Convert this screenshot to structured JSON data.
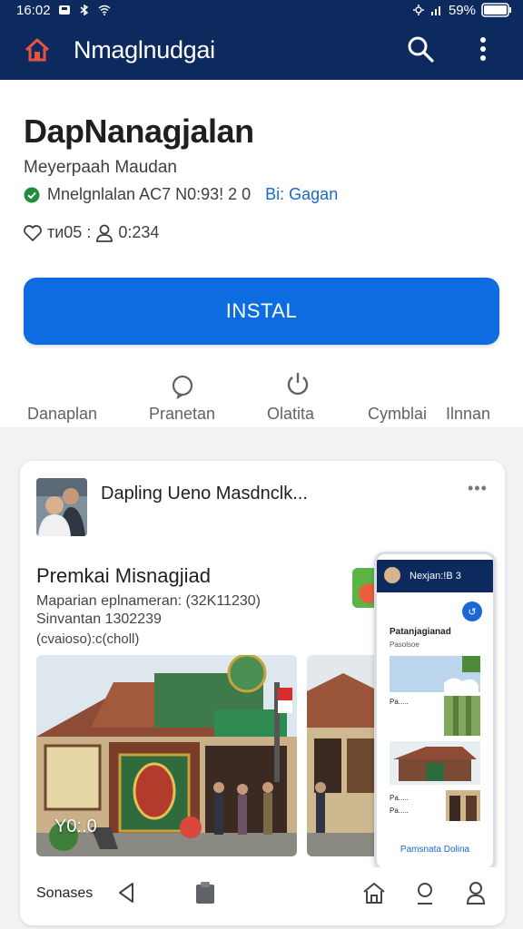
{
  "status": {
    "time": "16:02",
    "battery": "59%"
  },
  "appbar": {
    "title": "Nmaglnudgai"
  },
  "app": {
    "title": "DapNanagjalan",
    "publisher": "Meyerpaah Maudan",
    "verified_text": "Mnelgnlalan AC7 N0:93! 2 0",
    "verified_link": "Bi: Gagan",
    "stats_left": "ти05 :",
    "stats_right": "0:234",
    "install_label": "INSTAL"
  },
  "actions": [
    {
      "label": "Danaplan",
      "icon": "none"
    },
    {
      "label": "Pranetan",
      "icon": "comment-icon"
    },
    {
      "label": "Olatita",
      "icon": "power-icon"
    },
    {
      "label": "Cymblai",
      "icon": "none"
    },
    {
      "label": "Ilnnan",
      "icon": "none"
    }
  ],
  "card": {
    "header": "Dapling Ueno Masdnclk...",
    "more": "•••",
    "post_title": "Premkai Misnagjiad",
    "line1": "Maparian eplnameran: (32K11230)",
    "line2": "Sinvantan 1302239",
    "line3": "(cvaioso):c(choll)",
    "photo_label": "Y0:.0",
    "bottom_label": "Sonases"
  },
  "phone": {
    "bar_title": "Nexjan:!B 3",
    "fab": "↺",
    "heading": "Patanjagianad",
    "sub": "Pasolsoe",
    "tag1": "Pa.....",
    "tag2": "Pa.....",
    "tag3": "Pa.....",
    "cta": "Pamsnata Dolina"
  },
  "colors": {
    "appbar": "#0d2a5e",
    "install": "#0d6de0",
    "link": "#1967d2",
    "verified": "#1e8e3e",
    "home_icon": "#e8543e"
  }
}
